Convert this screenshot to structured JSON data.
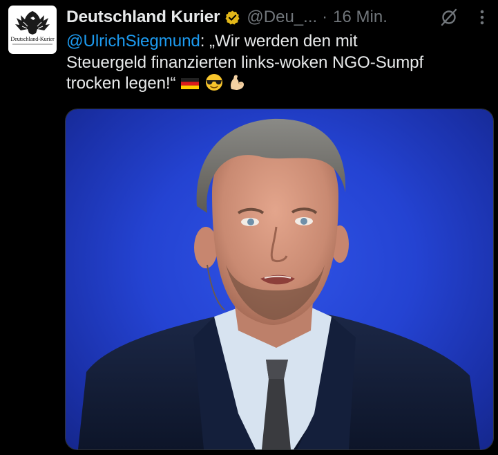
{
  "tweet": {
    "author_name": "Deutschland Kurier",
    "handle": "@Deu_...",
    "separator": "·",
    "time": "16 Min.",
    "avatar_logo_text": "Deutschland-Kurier",
    "mention": "@UlrichSiegmund",
    "body_line1_rest": ": „Wir werden den mit",
    "body_line2": "Steuergeld finanzierten links-woken NGO-Sumpf",
    "body_line3": "trocken legen!“",
    "emojis": [
      "german-flag",
      "sunglasses-face",
      "flexed-biceps"
    ],
    "icons": [
      "verified-badge",
      "grok-icon",
      "more-options-icon"
    ]
  },
  "colors": {
    "background": "#000000",
    "text": "#e7e9ea",
    "muted": "#71767b",
    "link": "#1d9bf0",
    "verified": "#e2b719",
    "media_bg": "#2443d2"
  }
}
